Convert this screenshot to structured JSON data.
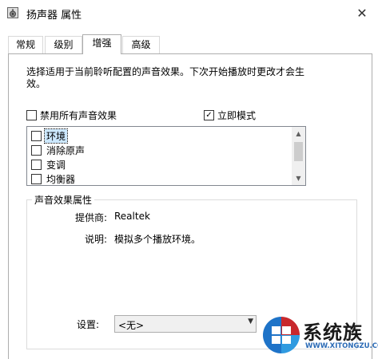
{
  "window": {
    "title": "扬声器 属性",
    "close_symbol": "✕"
  },
  "tabs": [
    {
      "label": "常规"
    },
    {
      "label": "级别"
    },
    {
      "label": "增强"
    },
    {
      "label": "高级"
    }
  ],
  "active_tab": "增强",
  "enhancement": {
    "description": "选择适用于当前聆听配置的声音效果。下次开始播放时更改才会生效。",
    "disable_all": {
      "label": "禁用所有声音效果",
      "checked": false
    },
    "immediate_mode": {
      "label": "立即模式",
      "checked": true
    },
    "effects": [
      {
        "label": "环境",
        "checked": false,
        "selected": true
      },
      {
        "label": "消除原声",
        "checked": false,
        "selected": false
      },
      {
        "label": "变调",
        "checked": false,
        "selected": false
      },
      {
        "label": "均衡器",
        "checked": false,
        "selected": false
      }
    ]
  },
  "properties": {
    "group_title": "声音效果属性",
    "provider_label": "提供商:",
    "provider_value": "Realtek",
    "description_label": "说明:",
    "description_value": "模拟多个播放环境。",
    "settings_label": "设置:",
    "settings_value": "<无>"
  },
  "watermark": {
    "brand": "系统族",
    "url": "WWW.XITONGZU.COM"
  },
  "colors": {
    "selection": "#cce8ff",
    "logo_blue": "#1e73c8",
    "logo_red": "#c8282d"
  }
}
